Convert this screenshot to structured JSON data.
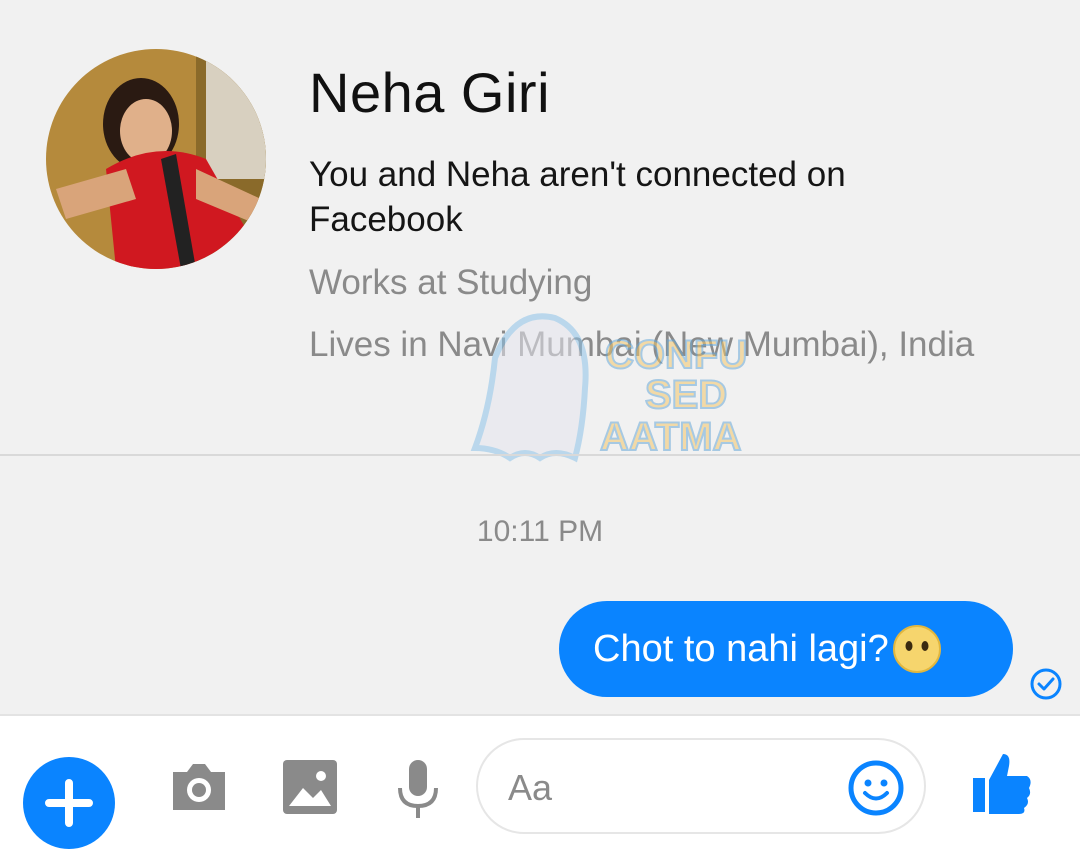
{
  "profile": {
    "name": "Neha Giri",
    "connection_text": "You and Neha aren't connected on Facebook",
    "work": "Works at Studying",
    "lives": "Lives in Navi Mumbai (New Mumbai), India"
  },
  "watermark": {
    "line1": "CONFU",
    "line2": "SED",
    "line3": "AATMA"
  },
  "conversation": {
    "timestamp": "10:11 PM",
    "message": "Chot to nahi lagi?",
    "message_status": "sent-check-icon"
  },
  "composer": {
    "input_placeholder": "Aa",
    "icons": [
      "plus-icon",
      "camera-icon",
      "gallery-icon",
      "microphone-icon",
      "emoji-icon",
      "thumbs-up-icon"
    ],
    "accent_color": "#0a84ff"
  }
}
